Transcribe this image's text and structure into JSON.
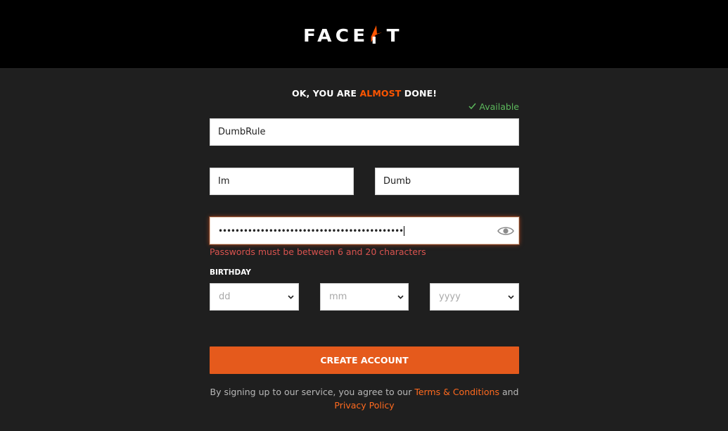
{
  "header": {
    "logo_text_left": "FACE",
    "logo_text_right": "T",
    "logo_icon": "faceit-flag-icon"
  },
  "form": {
    "headline_prefix": "OK, YOU ARE ",
    "headline_accent": "ALMOST",
    "headline_suffix": " DONE!",
    "availability_status": "Available",
    "availability_icon": "check-icon",
    "username_value": "DumbRule",
    "first_name_value": "Im",
    "last_name_value": "Dumb",
    "password_masked": "••••••••••••••••••••••••••••••••••••••••••••",
    "password_toggle_icon": "eye-icon",
    "password_error": "Passwords must be between 6 and 20 characters",
    "birthday_label": "BIRTHDAY",
    "birthday_day_placeholder": "dd",
    "birthday_month_placeholder": "mm",
    "birthday_year_placeholder": "yyyy",
    "create_button_label": "CREATE ACCOUNT",
    "terms_prefix": "By signing up to our service, you agree to our ",
    "terms_link": "Terms & Conditions",
    "terms_and": " and",
    "privacy_link": "Privacy Policy"
  },
  "colors": {
    "accent": "#e55a1c",
    "success": "#5cb85c",
    "error": "#d9534f",
    "background": "#1f1f1f",
    "header_background": "#000000"
  }
}
